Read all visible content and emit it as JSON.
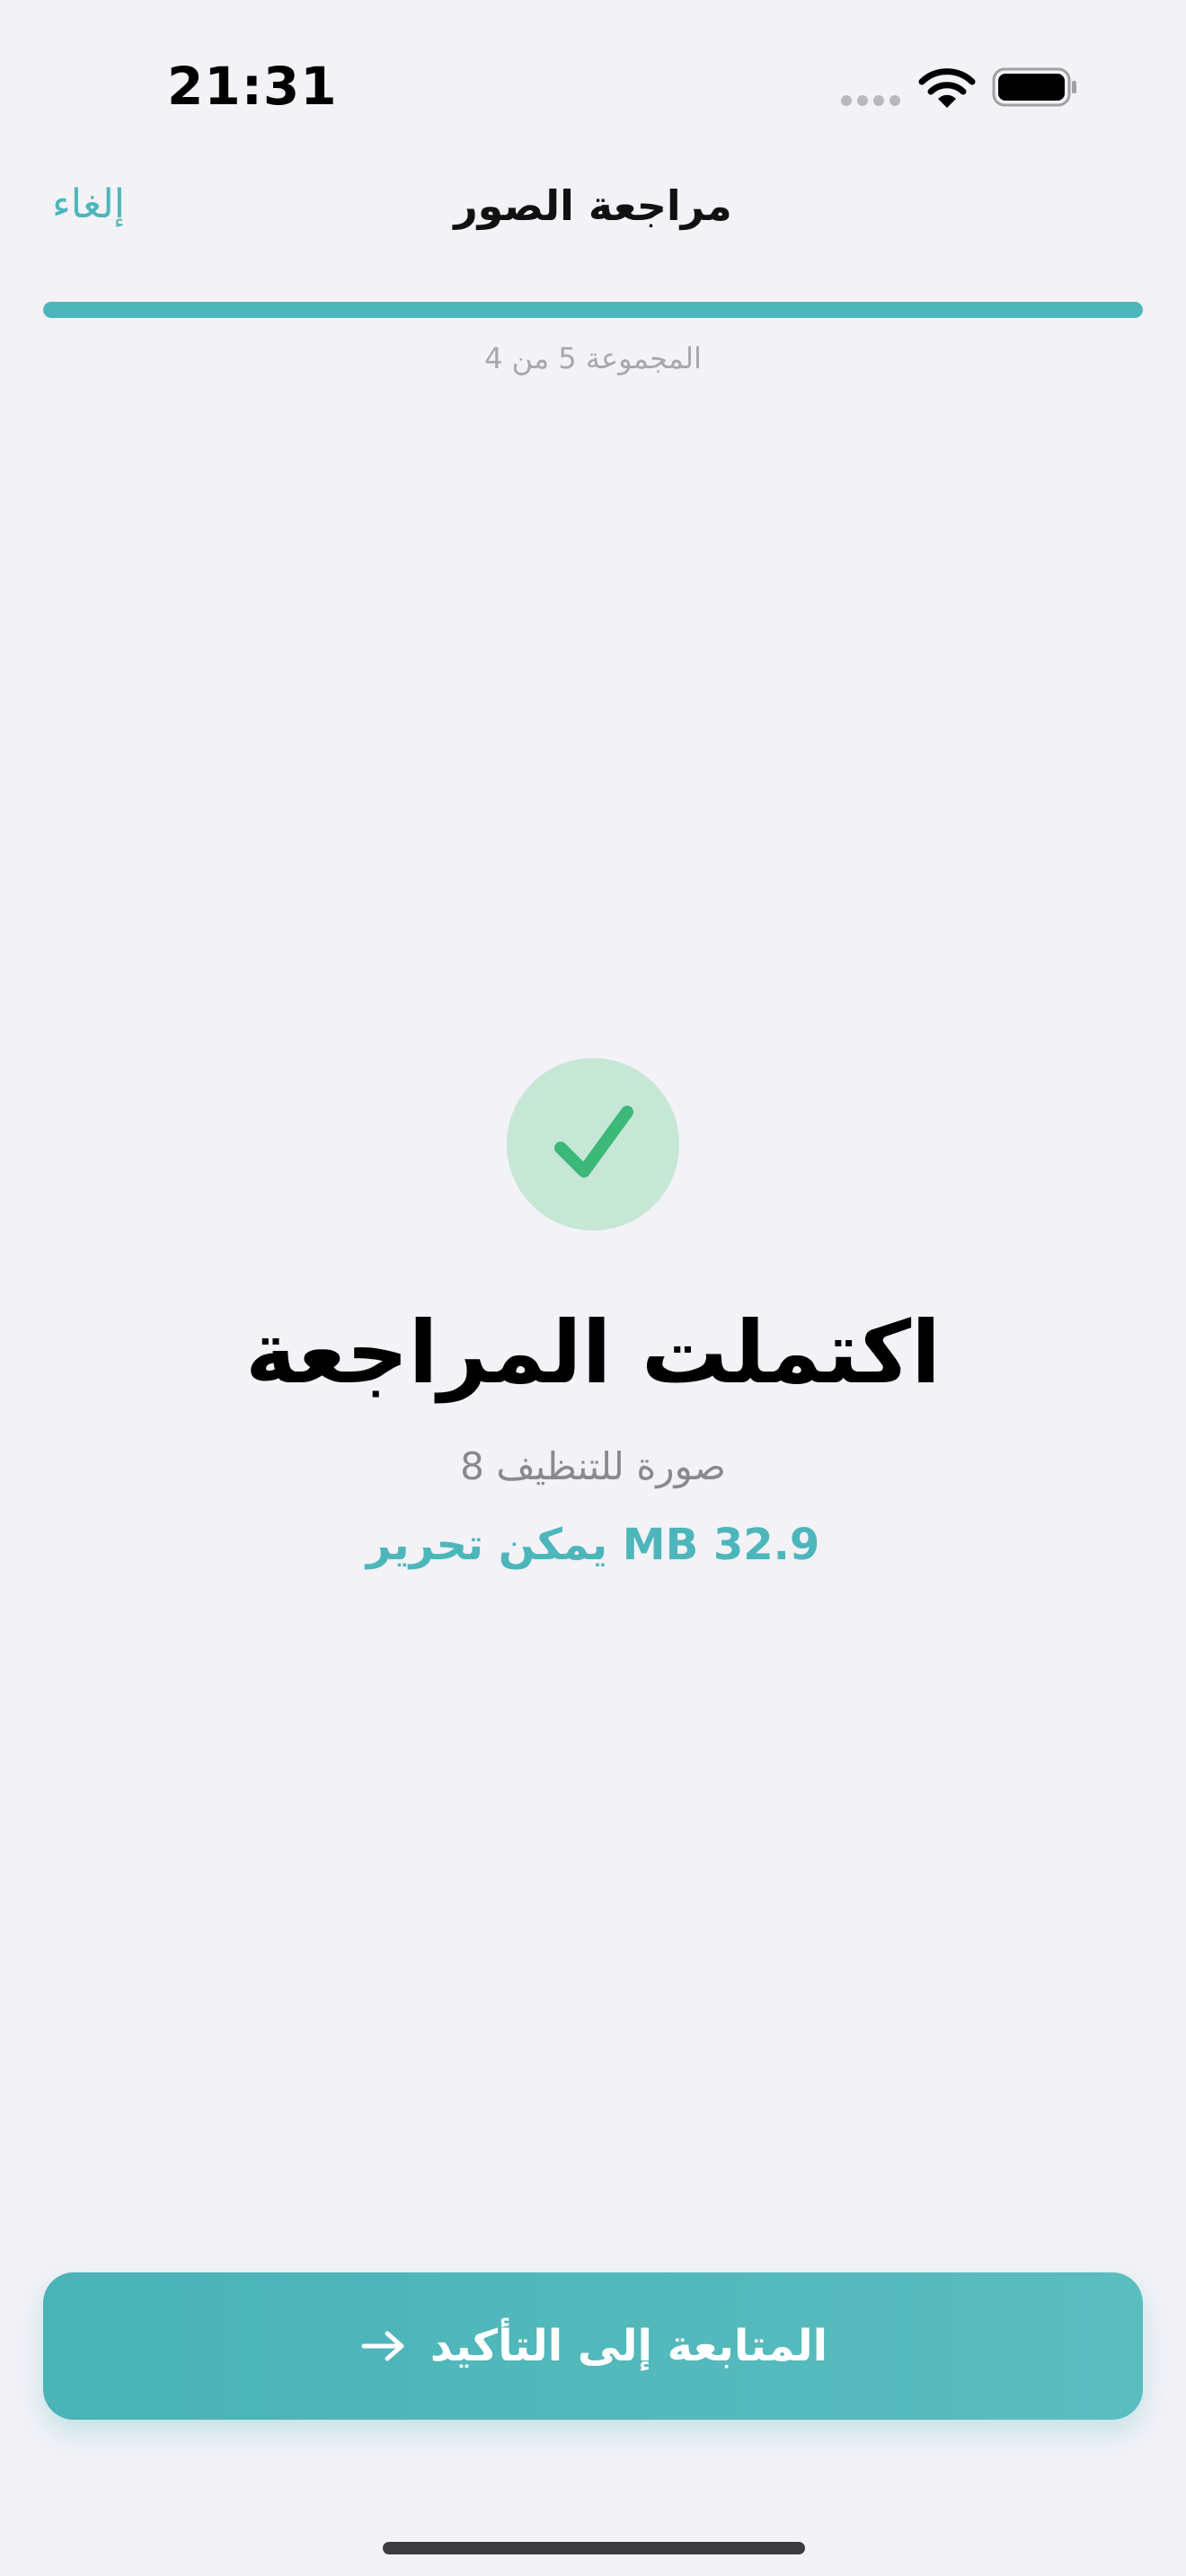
{
  "status_bar": {
    "time": "21:31",
    "icons": [
      "signal-dots-icon",
      "wifi-icon",
      "battery-icon"
    ]
  },
  "nav": {
    "cancel_label": "إلغاء",
    "title": "مراجعة الصور"
  },
  "progress": {
    "label": "المجموعة 5 من 4",
    "fraction": 1.0
  },
  "result": {
    "icon": "checkmark-icon",
    "heading": "اكتملت المراجعة",
    "count_text": "8 صورة للتنظيف",
    "space_text": "يمكن تحرير MB 32.9"
  },
  "footer": {
    "continue_label": "المتابعة إلى التأكيد",
    "continue_icon": "arrow-right-icon"
  },
  "colors": {
    "accent": "#4DB6BB",
    "success": "#3CB878",
    "success_bg": "#C6E6D6",
    "background": "#F2F2F7"
  }
}
